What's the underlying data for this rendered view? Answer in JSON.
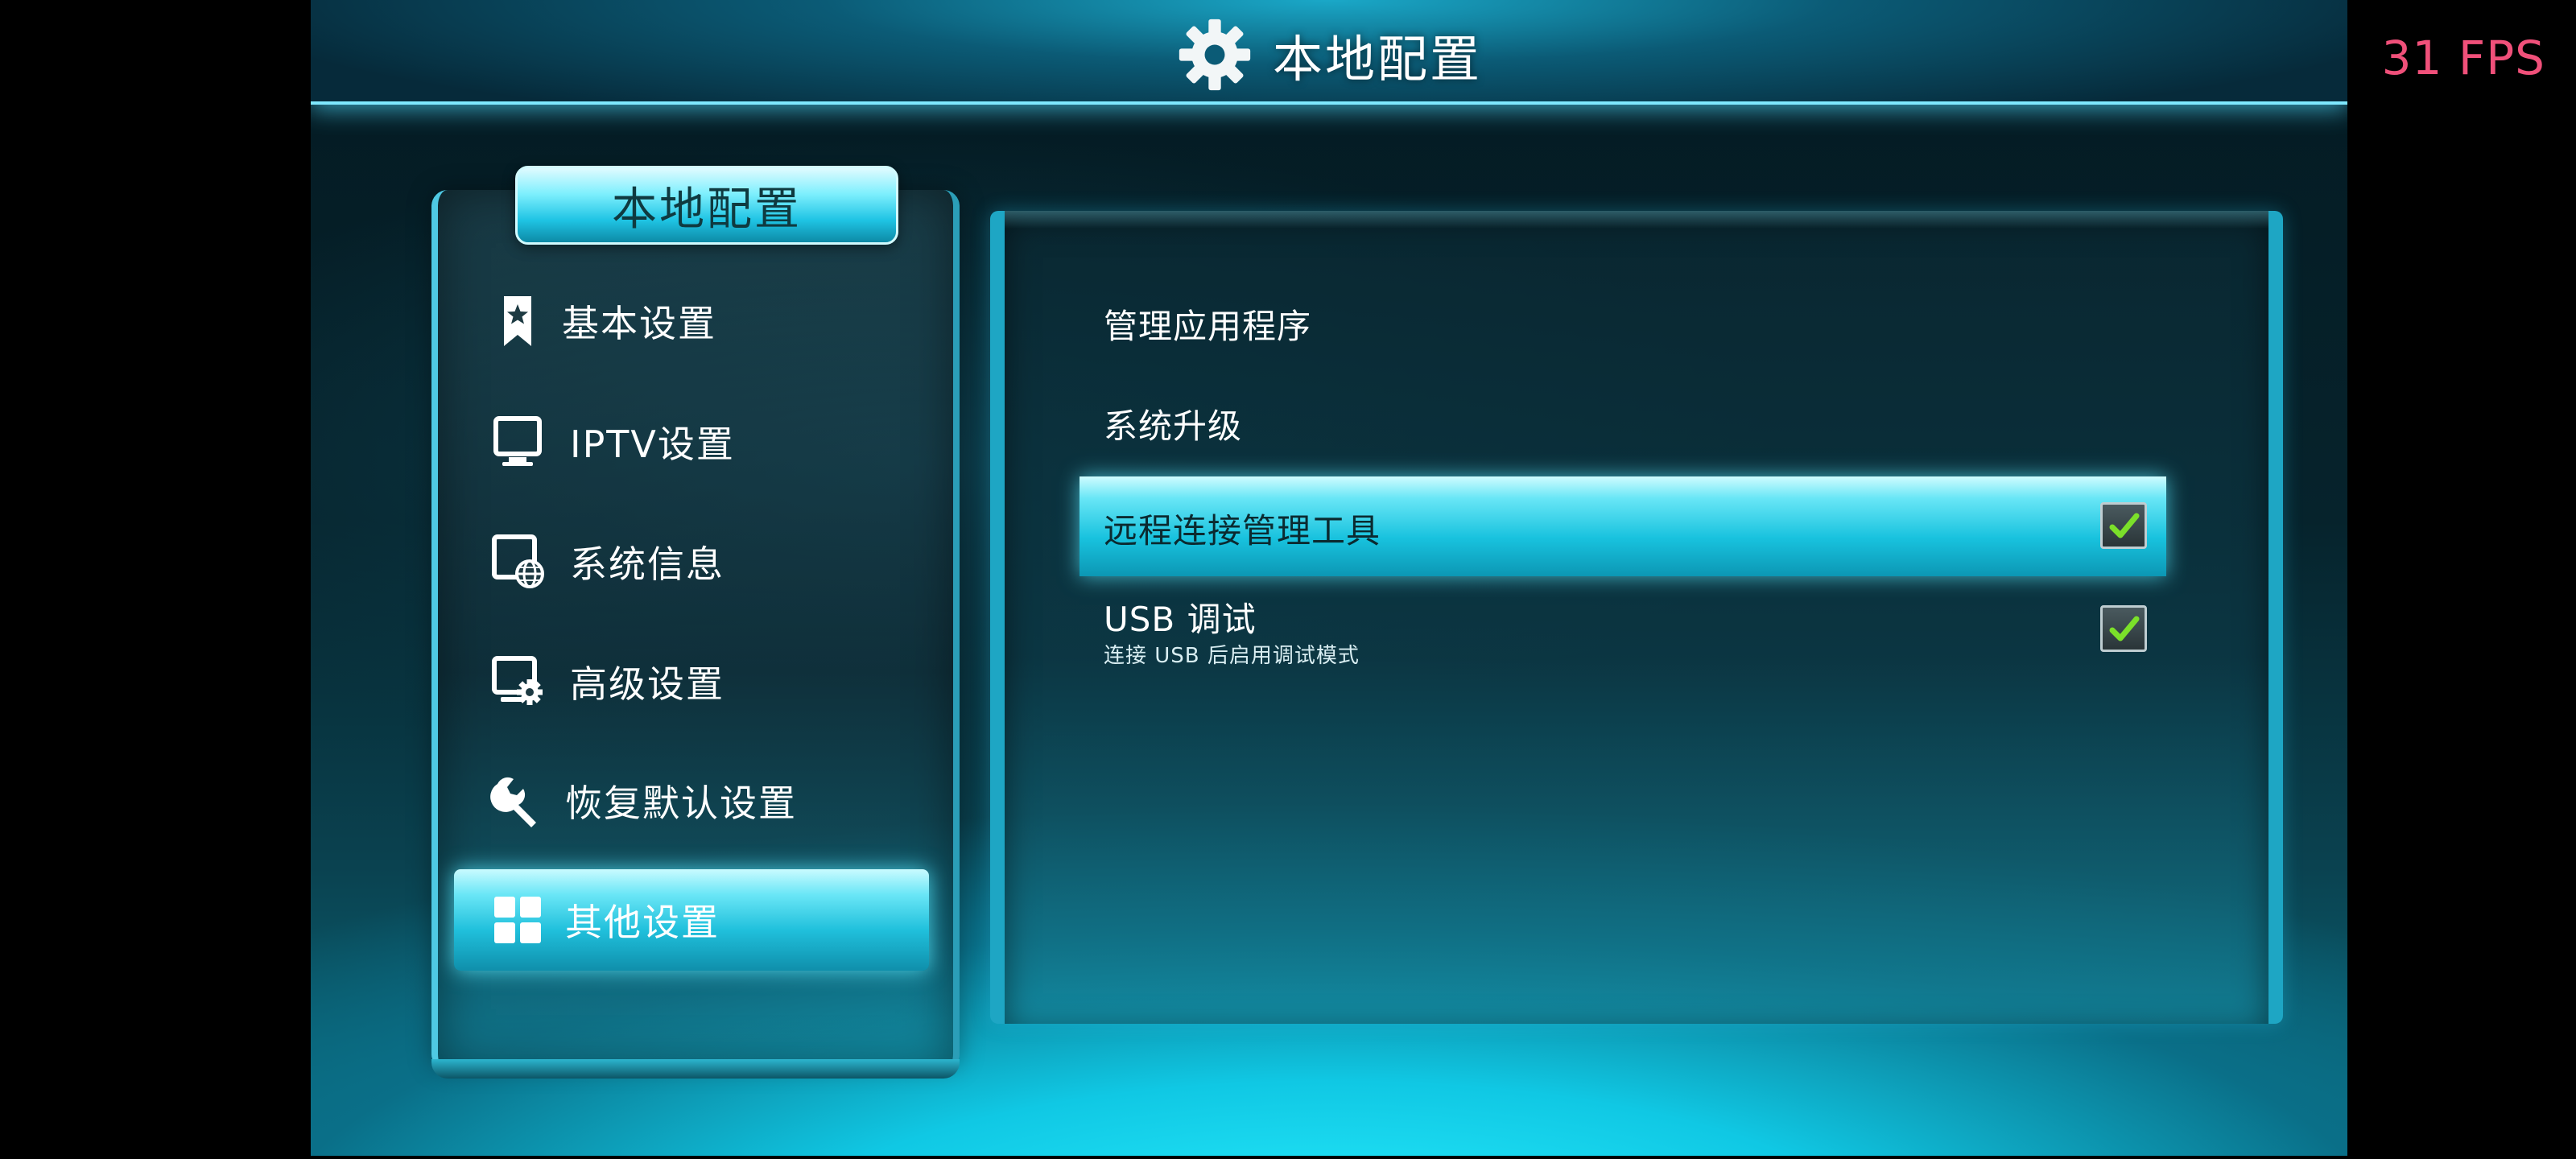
{
  "fps_counter": "31 FPS",
  "header": {
    "title": "本地配置",
    "icon": "gear-icon"
  },
  "left_panel": {
    "tab_title": "本地配置",
    "items": [
      {
        "label": "基本设置",
        "icon": "bookmark-star-icon",
        "selected": false
      },
      {
        "label": "IPTV设置",
        "icon": "monitor-icon",
        "selected": false
      },
      {
        "label": "系统信息",
        "icon": "globe-window-icon",
        "selected": false
      },
      {
        "label": "高级设置",
        "icon": "monitor-gear-icon",
        "selected": false
      },
      {
        "label": "恢复默认设置",
        "icon": "wrench-icon",
        "selected": false
      },
      {
        "label": "其他设置",
        "icon": "grid-icon",
        "selected": true
      }
    ]
  },
  "right_panel": {
    "options": [
      {
        "label": "管理应用程序"
      },
      {
        "label": "系统升级"
      },
      {
        "label": "远程连接管理工具",
        "checked": true,
        "selected": true
      },
      {
        "label": "USB 调试",
        "sublabel": "连接 USB 后启用调试模式",
        "checked": true
      }
    ]
  },
  "colors": {
    "accent": "#1fc4e4",
    "highlight": "#6ae6f6",
    "checkmark": "#7be02a",
    "fps_text": "#f0507a"
  }
}
